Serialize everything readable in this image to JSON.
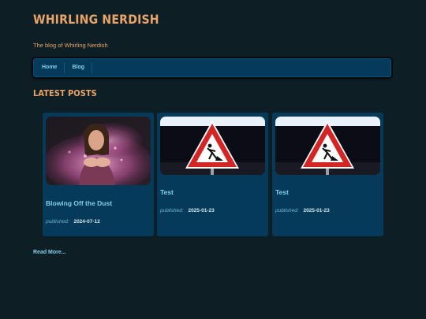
{
  "site": {
    "title": "WHIRLING NERDISH",
    "tagline": "The blog of Whirling Nerdish"
  },
  "nav": {
    "items": [
      {
        "label": "Home"
      },
      {
        "label": "Blog"
      }
    ]
  },
  "latest": {
    "heading": "LATEST POSTS",
    "posts": [
      {
        "title": "Blowing Off the Dust",
        "published_label": "published:",
        "date": "2024-07-12",
        "thumbnail": "photo-woman-blowing-pink-dust"
      },
      {
        "title": "Test",
        "published_label": "published:",
        "date": "2025-01-23",
        "thumbnail": "construction-warning-sign"
      },
      {
        "title": "Test",
        "published_label": "published:",
        "date": "2025-01-23",
        "thumbnail": "construction-warning-sign"
      }
    ],
    "read_more": "Read More..."
  },
  "colors": {
    "background": "#0d1f24",
    "card": "#063a5b",
    "accent_orange": "#e9a46a",
    "link_blue": "#7fd0ea"
  }
}
